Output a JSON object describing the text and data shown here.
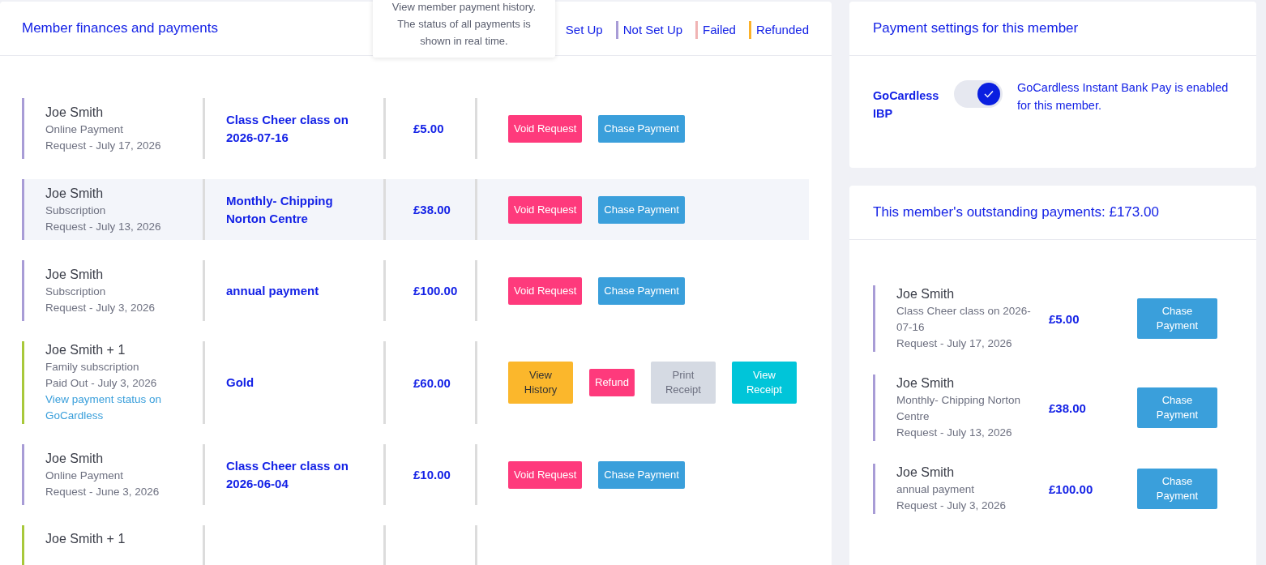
{
  "finances": {
    "title": "Member finances and payments",
    "legend": [
      {
        "label": "Set Up"
      },
      {
        "label": "Not Set Up",
        "color": "#a89cd6"
      },
      {
        "label": "Failed",
        "color": "#f0b4b4"
      },
      {
        "label": "Refunded",
        "color": "#fbb12a"
      }
    ],
    "tooltip": "View member payment history. The status of all payments is shown in real time.",
    "rows": [
      {
        "name": "Joe Smith",
        "type": "Online Payment",
        "status": "Request - July 17, 2026",
        "color": "#a89cd6",
        "highlighted": false,
        "item": "Class Cheer class on 2026-07-16",
        "amount": "£5.00",
        "actions": [
          {
            "kind": "void",
            "label": "Void Request"
          },
          {
            "kind": "chase",
            "label": "Chase Payment"
          }
        ]
      },
      {
        "name": "Joe Smith",
        "type": "Subscription",
        "status": "Request - July 13, 2026",
        "color": "#a89cd6",
        "highlighted": true,
        "item": "Monthly- Chipping Norton Centre",
        "amount": "£38.00",
        "actions": [
          {
            "kind": "void",
            "label": "Void Request"
          },
          {
            "kind": "chase",
            "label": "Chase Payment"
          }
        ]
      },
      {
        "name": "Joe Smith",
        "type": "Subscription",
        "status": "Request - July 3, 2026",
        "color": "#a89cd6",
        "highlighted": false,
        "item": "annual payment",
        "amount": "£100.00",
        "actions": [
          {
            "kind": "void",
            "label": "Void Request"
          },
          {
            "kind": "chase",
            "label": "Chase Payment"
          }
        ]
      },
      {
        "name": "Joe Smith + 1",
        "type": "Family subscription",
        "status": "Paid Out - July 3, 2026",
        "link": "View payment status on GoCardless",
        "color": "#a8c83a",
        "highlighted": false,
        "item": "Gold",
        "amount": "£60.00",
        "actions": [
          {
            "kind": "history",
            "label": "View History"
          },
          {
            "kind": "refund",
            "label": "Refund"
          },
          {
            "kind": "print",
            "label": "Print Receipt"
          },
          {
            "kind": "receipt",
            "label": "View Receipt"
          }
        ]
      },
      {
        "name": "Joe Smith",
        "type": "Online Payment",
        "status": "Request - June 3, 2026",
        "color": "#a89cd6",
        "highlighted": false,
        "item": "Class Cheer class on 2026-06-04",
        "amount": "£10.00",
        "actions": [
          {
            "kind": "void",
            "label": "Void Request"
          },
          {
            "kind": "chase",
            "label": "Chase Payment"
          }
        ]
      },
      {
        "name": "Joe Smith + 1",
        "color": "#a8c83a",
        "highlighted": false
      }
    ]
  },
  "settings": {
    "title": "Payment settings for this member",
    "label": "GoCardless IBP",
    "on": true,
    "description": "GoCardless Instant Bank Pay is enabled for this member."
  },
  "outstanding": {
    "title": "This member's outstanding payments: £173.00",
    "items": [
      {
        "name": "Joe Smith",
        "item": "Class Cheer class on 2026-07-16",
        "status": "Request - July 17, 2026",
        "color": "#a89cd6",
        "amount": "£5.00",
        "action": "Chase Payment"
      },
      {
        "name": "Joe Smith",
        "item": "Monthly- Chipping Norton Centre",
        "status": "Request - July 13, 2026",
        "color": "#a89cd6",
        "amount": "£38.00",
        "action": "Chase Payment"
      },
      {
        "name": "Joe Smith",
        "item": "annual payment",
        "status": "Request - July 3, 2026",
        "color": "#a89cd6",
        "amount": "£100.00",
        "action": "Chase Payment"
      }
    ]
  }
}
